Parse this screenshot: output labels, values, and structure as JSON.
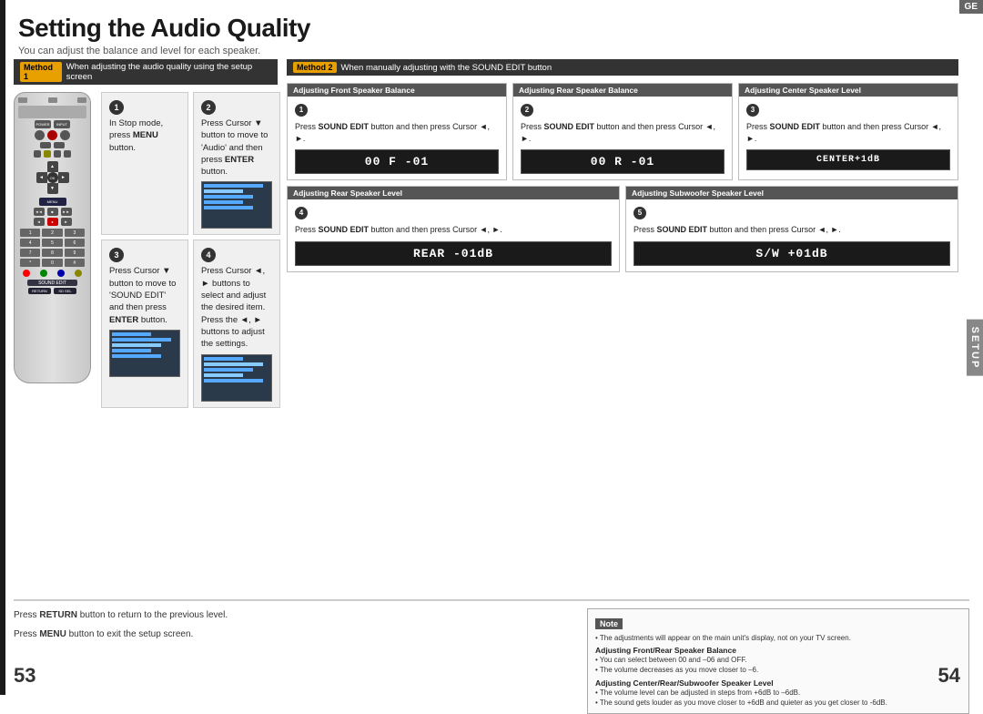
{
  "page": {
    "title": "Setting the Audio Quality",
    "subtitle": "You can adjust the balance and level for each speaker.",
    "page_num_left": "53",
    "page_num_right": "54",
    "ge_label": "GE",
    "setup_label": "SETUP"
  },
  "method1": {
    "badge": "Method 1",
    "title": "When adjusting the audio quality using the setup screen",
    "steps": [
      {
        "number": "1",
        "text": "In Stop mode, press MENU button."
      },
      {
        "number": "2",
        "text": "Press Cursor ▼ button to move to 'Audio' and then press ENTER button."
      },
      {
        "number": "3",
        "text": "Press Cursor ▼ button to move to 'SOUND EDIT' and then press ENTER button."
      },
      {
        "number": "4",
        "text": "Press Cursor ◄, ► buttons to select and adjust the desired item. Press the ◄, ► buttons to adjust the settings."
      }
    ]
  },
  "method2": {
    "badge": "Method 2",
    "title": "When manually adjusting with the SOUND EDIT button",
    "sections": [
      {
        "header": "Adjusting Front Speaker Balance",
        "step": "1",
        "text": "Press SOUND EDIT button and then press Cursor ◄, ►.",
        "display": "00 F -01"
      },
      {
        "header": "Adjusting Rear Speaker Balance",
        "step": "2",
        "text": "Press SOUND EDIT button and then press Cursor ◄, ►.",
        "display": "00 R -01"
      },
      {
        "header": "Adjusting Center Speaker Level",
        "step": "3",
        "text": "Press SOUND EDIT button and then press Cursor ◄, ►.",
        "display": "CENTER+1dB"
      },
      {
        "header": "Adjusting Rear Speaker Level",
        "step": "4",
        "text": "Press SOUND EDIT button and then press Cursor ◄, ►.",
        "display": "REAR -01dB"
      },
      {
        "header": "Adjusting Subwoofer Speaker Level",
        "step": "5",
        "text": "Press SOUND EDIT button and then press Cursor ◄, ►.",
        "display": "S/W +01dB"
      }
    ]
  },
  "bottom": {
    "return_text1": "Press RETURN button to return to the previous level.",
    "return_text2": "Press MENU button to exit the setup screen.",
    "note_title": "Note",
    "note_items": [
      "The adjustments will appear on the main unit's display, not on your TV screen.",
      "Adjusting Front/Rear Speaker Balance",
      "• You can select between 00 and –06 and OFF.",
      "• The volume decreases as you move closer to –6.",
      "Adjusting Center/Rear/Subwoofer Speaker Level",
      "• The volume level can be adjusted in steps from +6dB to –6dB.",
      "• The sound gets louder as you move closer to +6dB and quieter as you get closer to -6dB."
    ]
  }
}
